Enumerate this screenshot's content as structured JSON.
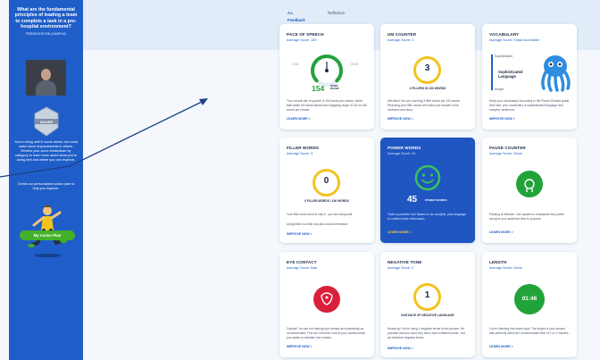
{
  "sidebar": {
    "question": "What are the fundamental principles of leading a team to complete a task in a pre-hospital environment?",
    "subtitle": "PRESENTATION (SAMPLE)",
    "badge_label": "SILVER",
    "message": "You're doing well in some areas, but could make some improvements in others. Review your score breakdown by category to learn more about what you're doing well and where you can improve.",
    "plan_prompt": "Check our personalized action plan to help you improve.",
    "action_button": "My Action Plan"
  },
  "tabs": [
    {
      "label": "A.I. Feedback",
      "active": true
    },
    {
      "label": "Reflection",
      "active": false
    }
  ],
  "cards": {
    "pace": {
      "title": "PACE OF SPEECH",
      "sub": "Average Score: 150",
      "low": "LOW",
      "high": "HIGH",
      "value": "154",
      "unit": "WORDS PER MIN",
      "desc": "Your overall rate of speech is 154 words per minute, which falls within the ideal natural and engaging range of 140 to 160 words per minute.",
      "link": "LEARN MORE >"
    },
    "um": {
      "title": "UM COUNTER",
      "sub": "Average Score: 4",
      "value": "3",
      "caption": "3 FILLERS IN 100 WORDS",
      "desc": "Attention! You are counting 3 filler words per 100 words. Reducing your filler words will make your answer more confident and clear.",
      "link": "IMPROVE NOW >"
    },
    "vocab": {
      "title": "VOCABULARY",
      "sub": "Average Score: Smart Accessible",
      "top": "Sophisticated",
      "level": "Sophisticated Language",
      "bottom": "Simple",
      "desc": "Keep your vocabulary! According to the Flesch-Kincaid grade level test, your vocabulary is sophisticated language and complex sentences.",
      "link": "IMPROVE NOW >"
    },
    "filler": {
      "title": "FILLER WORDS",
      "sub": "Average Score: 3",
      "value": "0",
      "caption": "0 FILLER WORDS / 100 WORDS",
      "desc": "Your filler word count is only 0 - you are doing well.",
      "desc2": "Using fillers too little can also sound rehearsed.",
      "link": "IMPROVE NOW >"
    },
    "power": {
      "title": "POWER WORDS",
      "sub": "Average Score: 30",
      "value": "45",
      "unit": "POWER WORDS",
      "desc": "That's a powerful mix! Based on our analysis, your language is confident and enthusiastic.",
      "link": "LEARN MORE >"
    },
    "pause": {
      "title": "PAUSE COUNTER",
      "sub": "Average Score: Great",
      "desc": "Pausing is effective. Use pauses to emphasize key points and give your audience time to process.",
      "link": "LEARN MORE >"
    },
    "eye": {
      "title": "EYE CONTACT",
      "sub": "Average Score: Bad",
      "desc": "Caution! You are not making eye contact as consistently as recommended. The rule of thumb: look at your camera when you speak to maintain eye contact.",
      "link": "IMPROVE NOW >"
    },
    "tone": {
      "title": "NEGATIVE TONE",
      "sub": "Average Score: 2",
      "value": "1",
      "caption": "INSTANCE OF NEGATIVE LANGUAGE",
      "desc": "Heads up! You're using 1 negative terms in this answer. It's possible that you used very direct and confident words - but we detected negative terms.",
      "link": "IMPROVE NOW >"
    },
    "length": {
      "title": "LENGTH",
      "sub": "Average Score: Great",
      "value": "01:46",
      "desc": "You're finishing that sweet spot. The length of your answer falls perfectly within the recommended time of 1 to 2 minutes.",
      "link": "LEARN MORE >"
    }
  },
  "colors": {
    "primary": "#1f5ec8",
    "good": "#22a33a",
    "warn": "#f2c320",
    "bad": "#d8203a"
  }
}
